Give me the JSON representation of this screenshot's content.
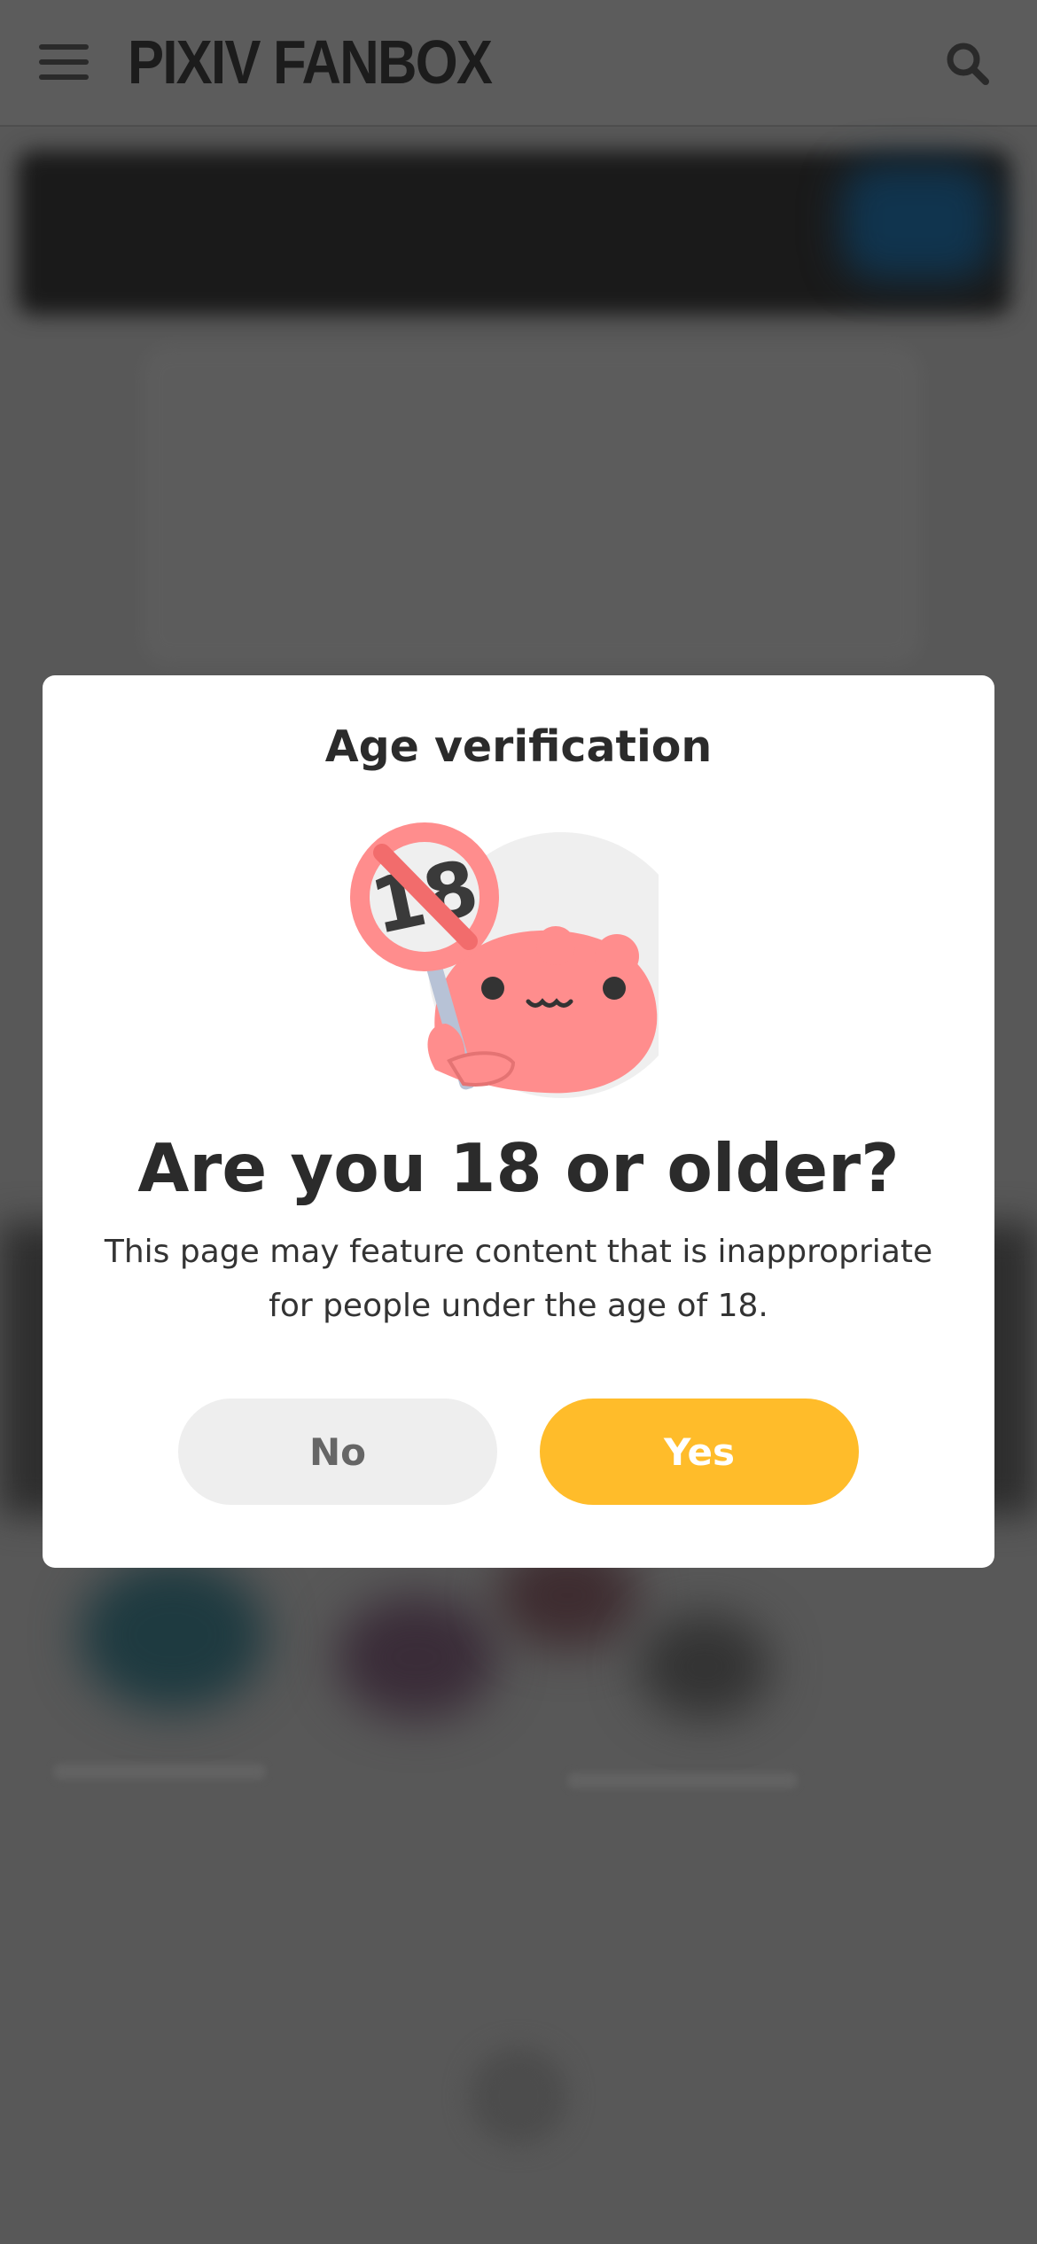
{
  "header": {
    "logo_text": "PIXIV FANBOX",
    "menu_icon": "hamburger-menu-icon",
    "search_icon": "search-icon"
  },
  "modal": {
    "title": "Age verification",
    "illustration": "under-18-prohibited-mascot",
    "question": "Are you 18 or older?",
    "description": "This page may feature content that is inappropriate for people under the age of 18.",
    "no_label": "No",
    "yes_label": "Yes"
  },
  "colors": {
    "overlay_page": "#585858",
    "modal_bg": "#ffffff",
    "text": "#2b2b2b",
    "no_button_bg": "#eeeeee",
    "no_button_text": "#666666",
    "yes_button_bg": "#ffbc2a",
    "yes_button_text": "#ffffff",
    "mascot_pink": "#ff8d8d",
    "prohibit_red": "#f26c6c"
  }
}
